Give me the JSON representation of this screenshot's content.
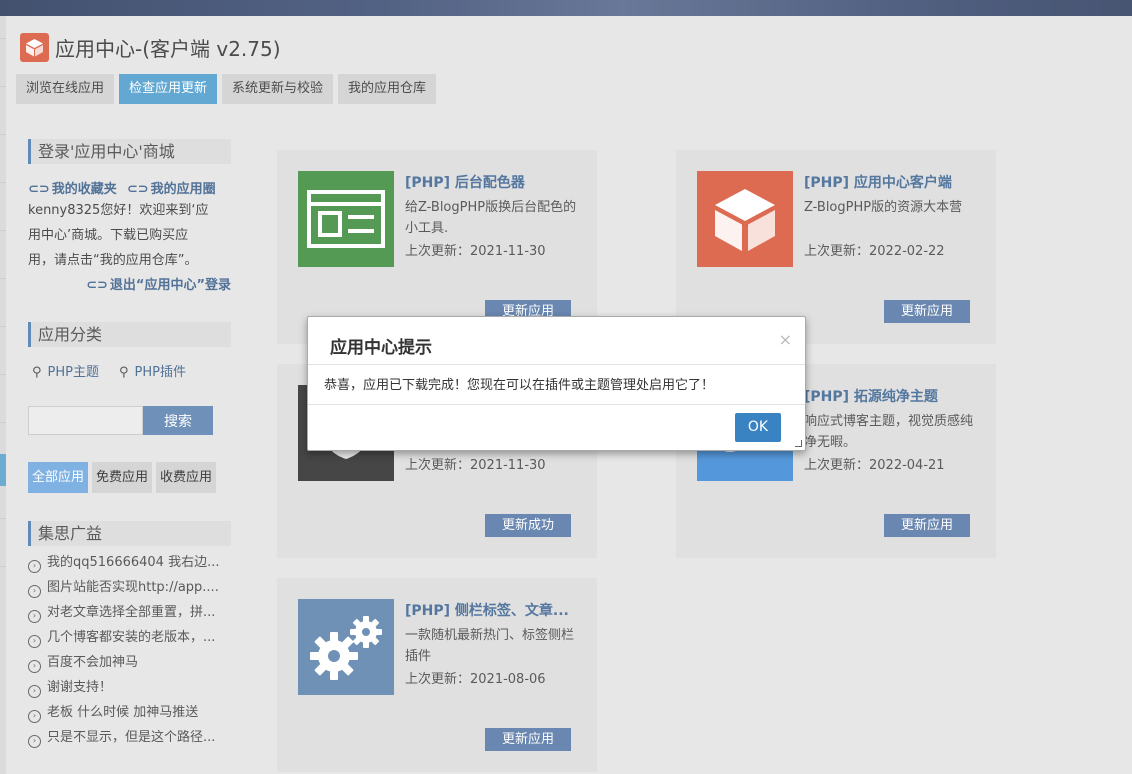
{
  "app": {
    "title": "应用中心-(客户端 v2.75)",
    "logo_icon": "cube-icon",
    "accent_color": "#d9573b"
  },
  "tabs": [
    {
      "label": "浏览在线应用",
      "active": false
    },
    {
      "label": "检查应用更新",
      "active": true
    },
    {
      "label": "系统更新与校验",
      "active": false
    },
    {
      "label": "我的应用仓库",
      "active": false
    }
  ],
  "sidebar": {
    "login_title": "登录'应用中心'商城",
    "favorites_link": "我的收藏夹",
    "my_apps_link": "我的应用圈",
    "welcome_lines": [
      "kenny8325您好！欢迎来到‘应",
      "用中心’商城。下载已购买应",
      "用，请点击“我的应用仓库”。"
    ],
    "logout_link": "退出“应用中心”登录",
    "category_title": "应用分类",
    "categories": [
      "PHP主题",
      "PHP插件"
    ],
    "search_placeholder": "",
    "search_button": "搜索",
    "filters": [
      {
        "label": "全部应用",
        "active": true
      },
      {
        "label": "免费应用",
        "active": false
      },
      {
        "label": "收费应用",
        "active": false
      }
    ],
    "news_title": "集思广益",
    "news": [
      "我的qq516666404 我右边...",
      "图片站能否实现http://app....",
      "对老文章选择全部重置，拼...",
      "几个博客都安装的老版本，...",
      "百度不会加神马",
      "谢谢支持！",
      "老板 什么时候 加神马推送",
      "只是不显示，但是这个路径..."
    ]
  },
  "apps": [
    {
      "title": "[PHP] 后台配色器",
      "desc": "给Z-BlogPHP版换后台配色的小工具.",
      "date": "上次更新：2021-11-30",
      "button": "更新应用",
      "icon": "window-icon",
      "color": "#3d8b3d"
    },
    {
      "title": "[PHP] 应用中心客户端",
      "desc": "Z-BlogPHP版的资源大本营",
      "date": "上次更新：2022-02-22",
      "button": "更新应用",
      "icon": "cube-icon",
      "color": "#d9573b"
    },
    {
      "title": "",
      "desc": "",
      "date": "上次更新：2021-11-30",
      "button": "更新成功",
      "icon": "shield-icon",
      "color": "#2d2d2d"
    },
    {
      "title": "[PHP] 拓源纯净主题",
      "desc": "响应式博客主题，视觉质感纯净无暇。",
      "date": "上次更新：2022-04-21",
      "button": "更新应用",
      "icon": "theme-logo-icon",
      "color": "#3d8ad6"
    },
    {
      "title": "[PHP] 侧栏标签、文章...",
      "desc": "一款随机最新热门、标签侧栏插件",
      "date": "上次更新：2021-08-06",
      "button": "更新应用",
      "icon": "gears-icon",
      "color": "#5a82ab"
    }
  ],
  "dialog": {
    "title": "应用中心提示",
    "close": "×",
    "message": "恭喜，应用已下载完成！您现在可以在插件或主题管理处启用它了！",
    "ok": "OK"
  }
}
